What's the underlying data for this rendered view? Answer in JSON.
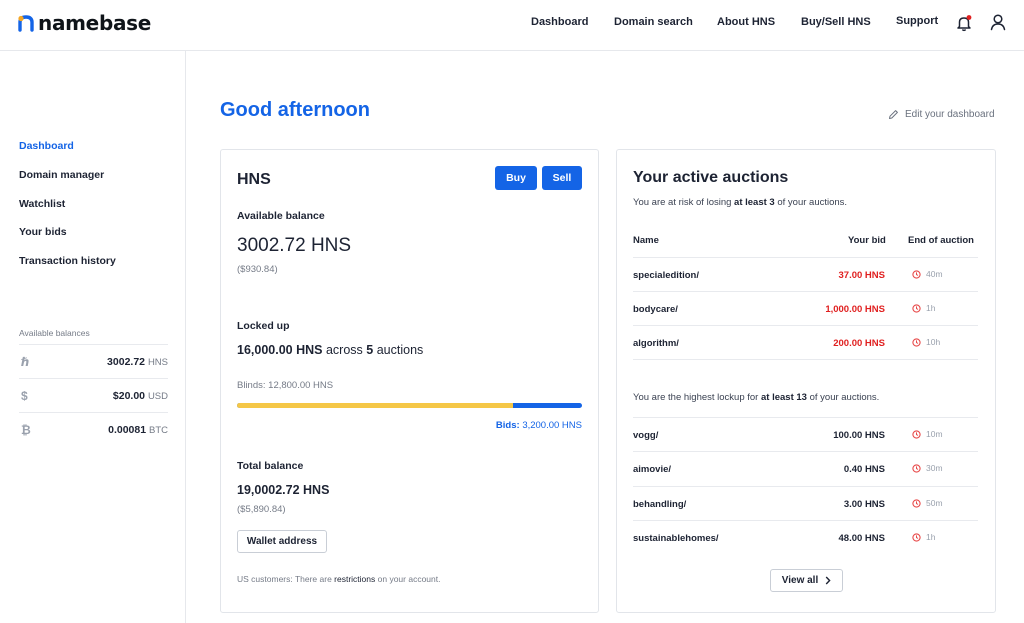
{
  "header": {
    "brand": "namebase",
    "nav": [
      "Dashboard",
      "Domain search",
      "About HNS",
      "Buy/Sell HNS",
      "Support"
    ],
    "icons": [
      "bell-icon",
      "user-icon"
    ],
    "notification_dot_color": "#e02020"
  },
  "sidebar": {
    "items": [
      {
        "label": "Dashboard",
        "active": true
      },
      {
        "label": "Domain manager"
      },
      {
        "label": "Watchlist"
      },
      {
        "label": "Your bids"
      },
      {
        "label": "Transaction history"
      }
    ],
    "balances_label": "Available balances",
    "balances": [
      {
        "icon": "hns-icon",
        "glyph": "ℏ",
        "amount": "3002.72",
        "unit": "HNS"
      },
      {
        "icon": "dollar-icon",
        "glyph": "$",
        "amount": "$20.00",
        "unit": "USD"
      },
      {
        "icon": "bitcoin-icon",
        "glyph": "₿",
        "amount": "0.00081",
        "unit": "BTC"
      }
    ]
  },
  "main": {
    "greeting": "Good afternoon",
    "edit_dashboard": "Edit your dashboard"
  },
  "hns_card": {
    "title": "HNS",
    "buy_label": "Buy",
    "sell_label": "Sell",
    "available_label": "Available balance",
    "available_value": "3002.72 HNS",
    "available_usd": "($930.84)",
    "locked_label": "Locked up",
    "locked_amount": "16,000.00 HNS",
    "locked_across": "across",
    "locked_count": "5",
    "locked_suffix": "auctions",
    "blinds_label": "Blinds:",
    "blinds_value": "12,800.00 HNS",
    "bids_label": "Bids:",
    "bids_value": "3,200.00 HNS",
    "blinds_fraction": 0.8,
    "total_label": "Total balance",
    "total_value": "19,0002.72 HNS",
    "total_usd": "($5,890.84)",
    "wallet_button": "Wallet address",
    "us_note_prefix": "US customers: There are",
    "us_note_link": "restrictions",
    "us_note_suffix": "on your account.",
    "colors": {
      "accent": "#1464e6",
      "blinds": "#f5c747"
    }
  },
  "auctions_card": {
    "title": "Your active auctions",
    "risk_prefix": "You are at risk of losing",
    "risk_bold": "at least 3",
    "risk_suffix": "of your auctions.",
    "columns": {
      "name": "Name",
      "bid": "Your bid",
      "end": "End of auction"
    },
    "losing": [
      {
        "name": "specialedition/",
        "bid": "37.00 HNS",
        "end": "40m"
      },
      {
        "name": "bodycare/",
        "bid": "1,000.00 HNS",
        "end": "1h"
      },
      {
        "name": "algorithm/",
        "bid": "200.00 HNS",
        "end": "10h"
      }
    ],
    "lead_prefix": "You are the highest lockup for",
    "lead_bold": "at least 13",
    "lead_suffix": "of your auctions.",
    "leading": [
      {
        "name": "vogg/",
        "bid": "100.00 HNS",
        "end": "10m"
      },
      {
        "name": "aimovie/",
        "bid": "0.40 HNS",
        "end": "30m"
      },
      {
        "name": "behandling/",
        "bid": "3.00 HNS",
        "end": "50m"
      },
      {
        "name": "sustainablehomes/",
        "bid": "48.00 HNS",
        "end": "1h"
      }
    ],
    "view_all": "View all",
    "colors": {
      "losing_bid": "#e02020",
      "timer_icon": "#e84a4a"
    }
  }
}
